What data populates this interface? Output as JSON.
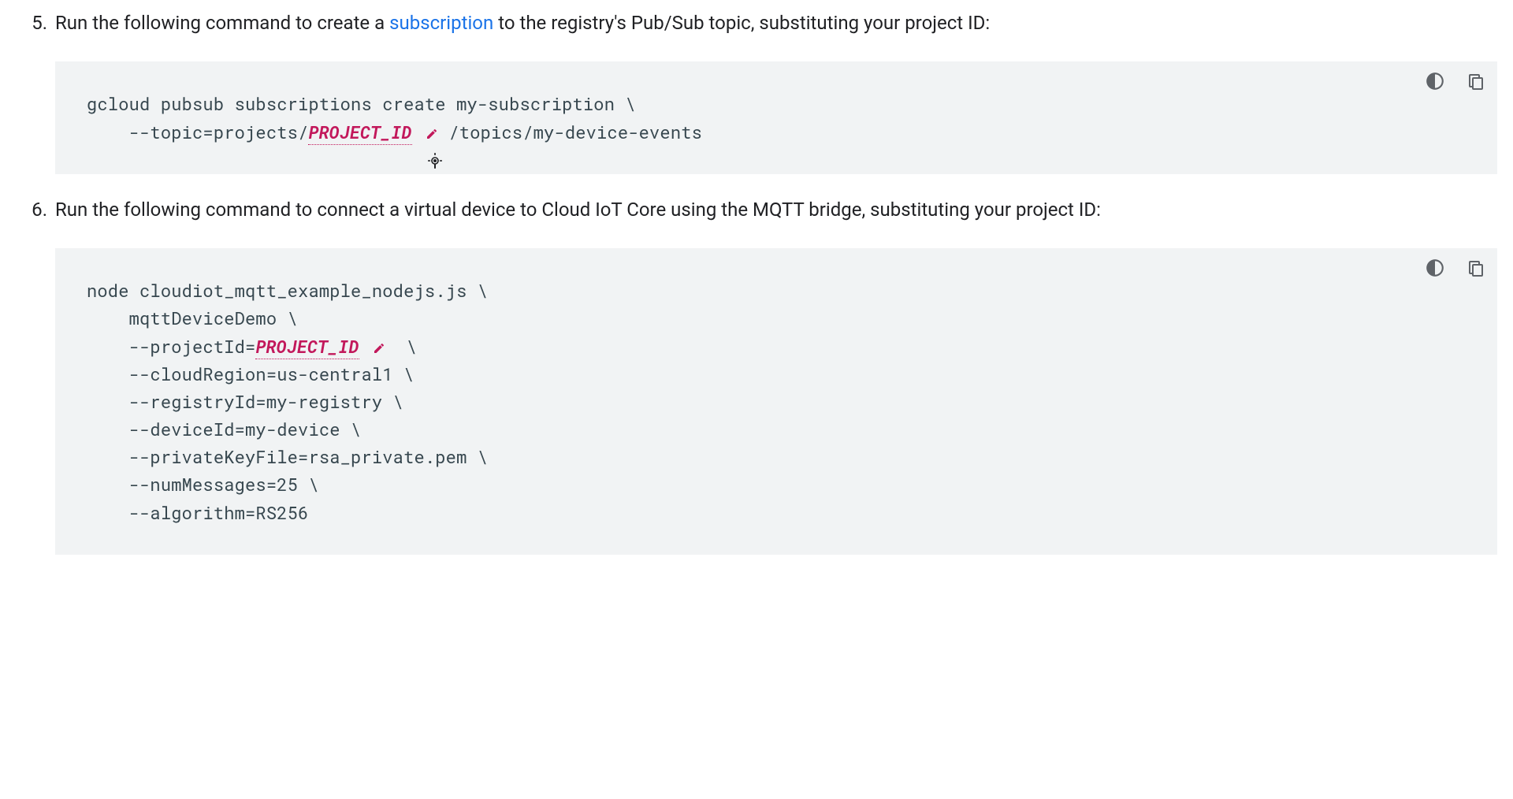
{
  "list": {
    "start": 5,
    "items": [
      {
        "text_before": "Run the following command to create a ",
        "link_text": "subscription",
        "text_after": " to the registry's Pub/Sub topic, substituting your project ID:"
      },
      {
        "text_full": "Run the following command to connect a virtual device to Cloud IoT Core using the MQTT bridge, substituting your project ID:"
      }
    ]
  },
  "code1": {
    "seg1": "gcloud pubsub subscriptions create my-subscription \\",
    "seg2_pre": "    --topic=projects/",
    "seg2_var": "PROJECT_ID",
    "seg2_post": "/topics/my-device-events"
  },
  "code2": {
    "l1": "node cloudiot_mqtt_example_nodejs.js \\",
    "l2": "    mqttDeviceDemo \\",
    "l3_pre": "    --projectId=",
    "l3_var": "PROJECT_ID",
    "l3_post": " \\",
    "l4": "    --cloudRegion=us-central1 \\",
    "l5": "    --registryId=my-registry \\",
    "l6": "    --deviceId=my-device \\",
    "l7": "    --privateKeyFile=rsa_private.pem \\",
    "l8": "    --numMessages=25 \\",
    "l9": "    --algorithm=RS256"
  },
  "icons": {
    "theme_toggle": "theme-toggle",
    "copy": "copy",
    "edit": "edit"
  }
}
